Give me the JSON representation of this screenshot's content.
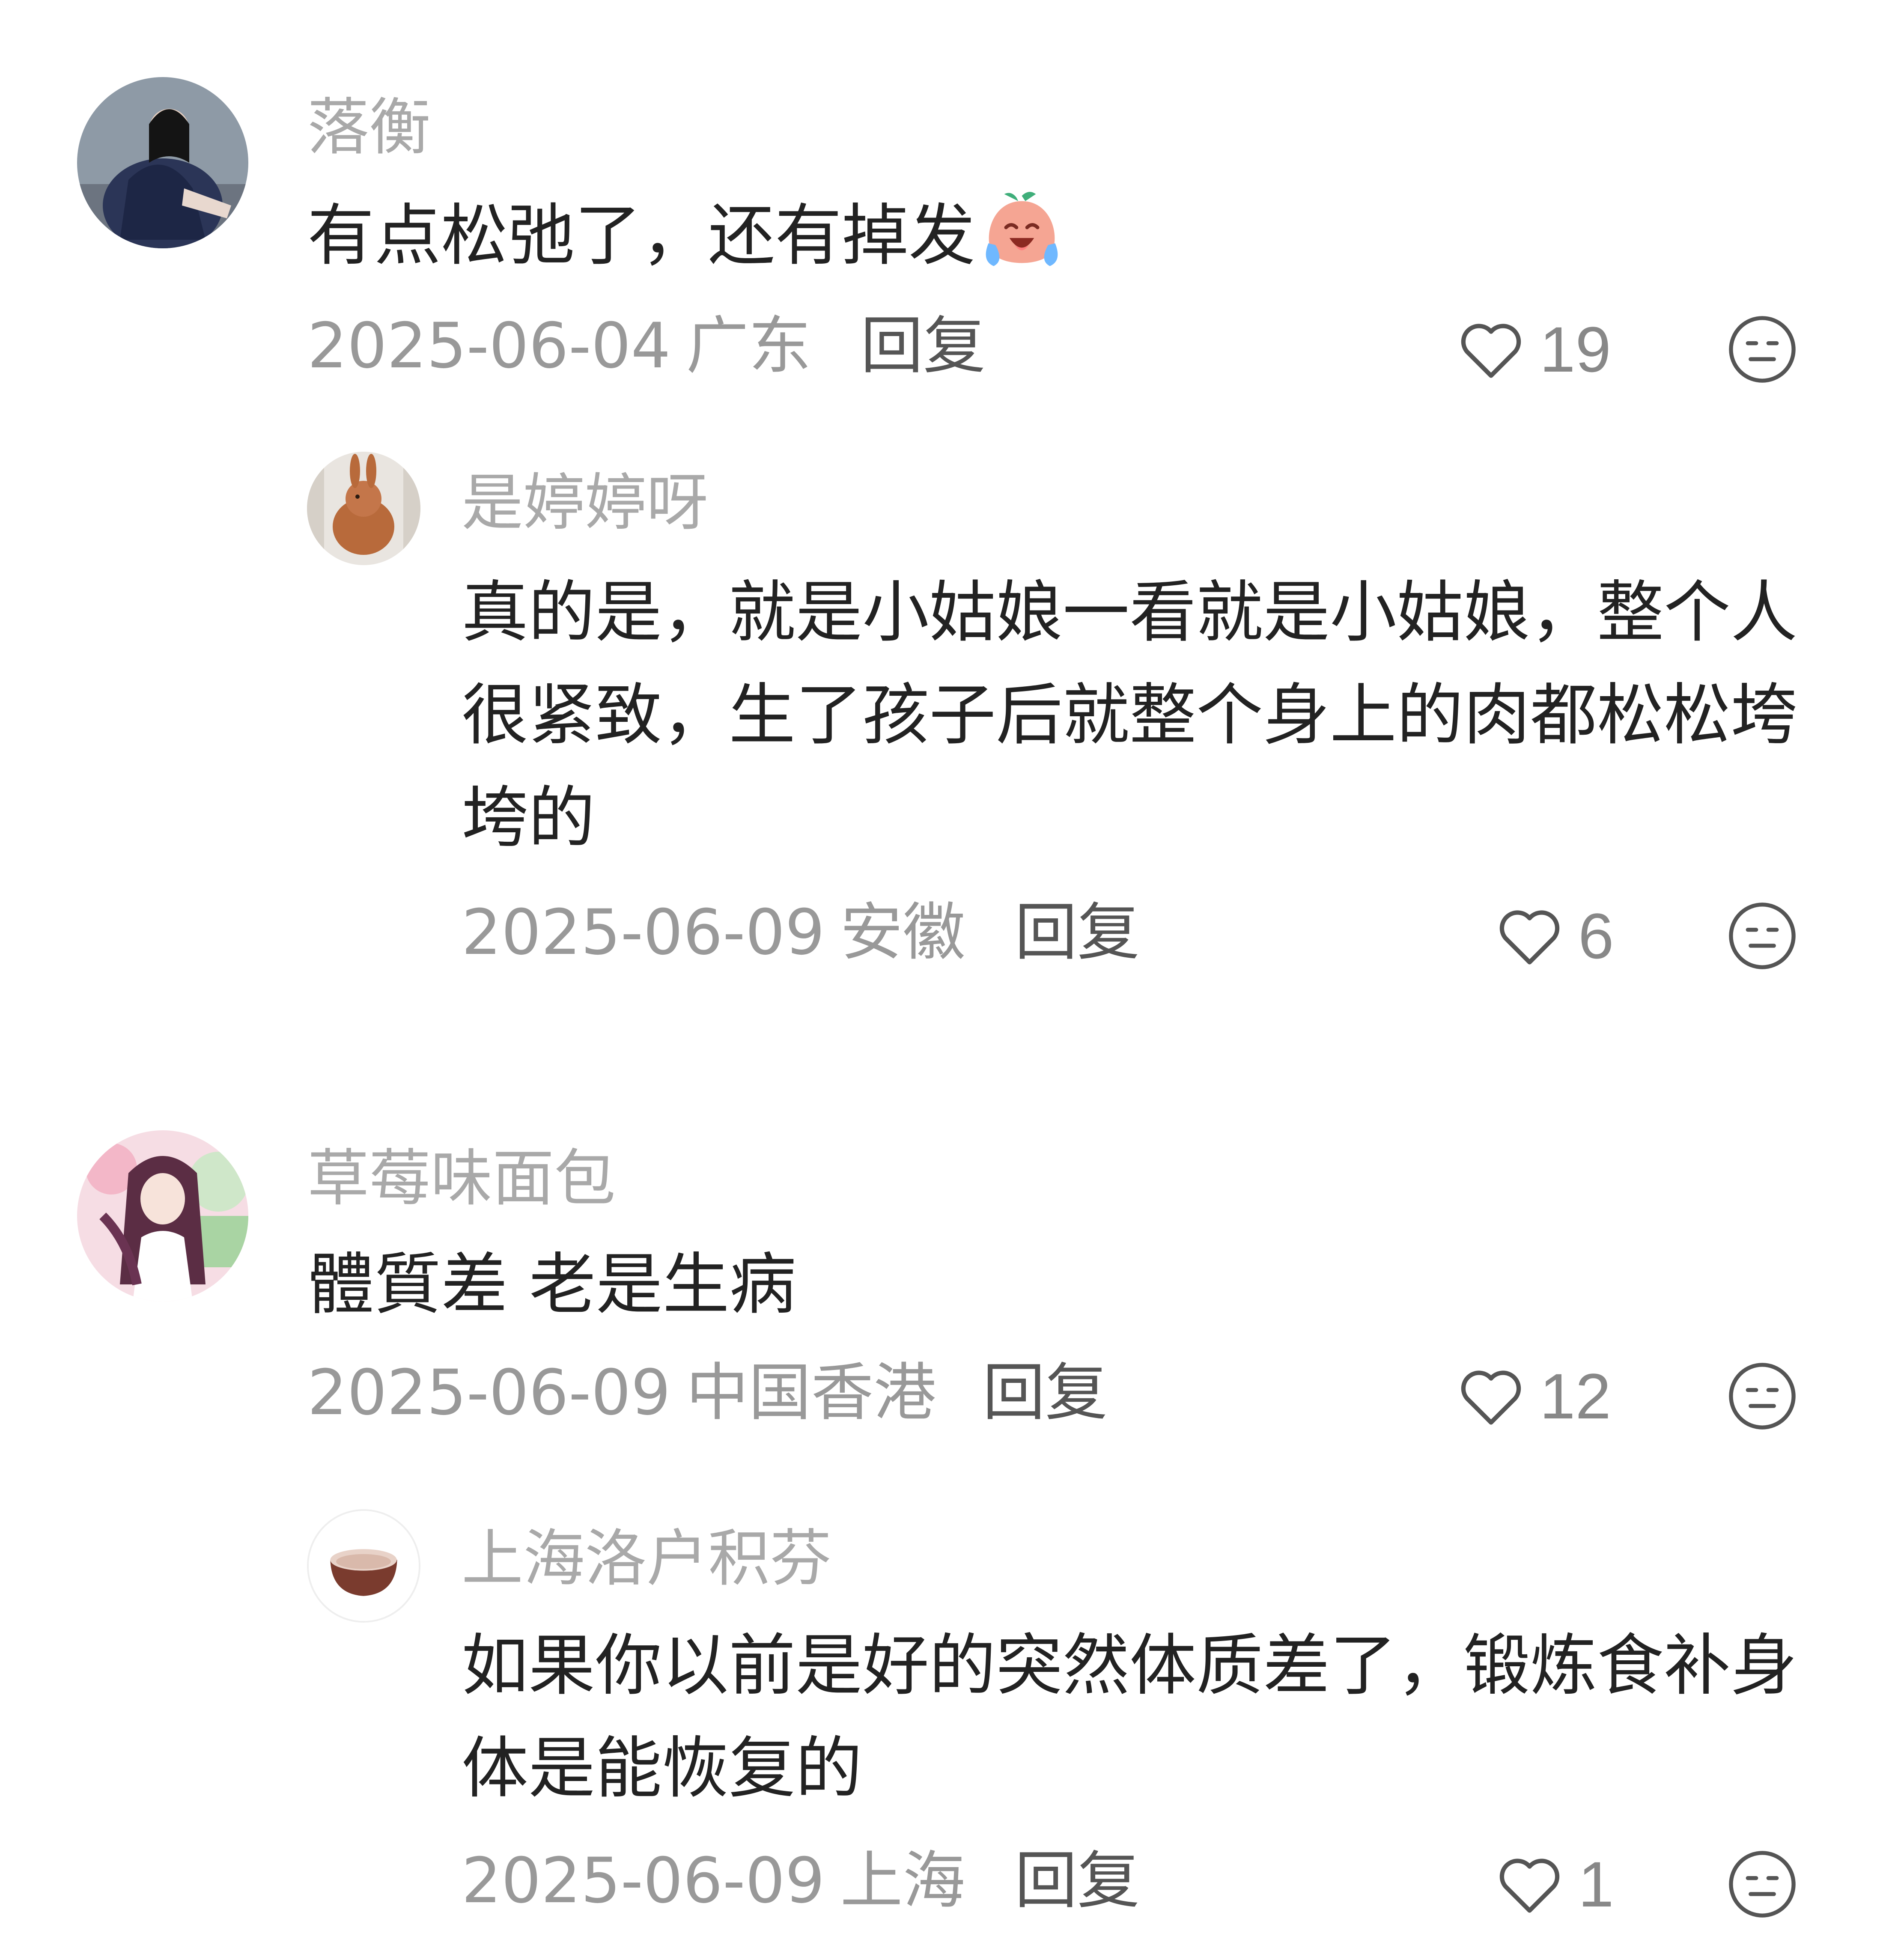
{
  "comments": [
    {
      "author": "落衡",
      "text": "有点松弛了，还有掉发",
      "emoji": "crying-laughing-peach-emoji",
      "date": "2025-06-04",
      "location": "广东",
      "reply_label": "回复",
      "likes": "19",
      "reply": {
        "author": "是婷婷呀",
        "text": "真的是，就是小姑娘一看就是小姑娘，整个人很紧致，生了孩子后就整个身上的肉都松松垮垮的",
        "date": "2025-06-09",
        "location": "安徽",
        "reply_label": "回复",
        "likes": "6"
      }
    },
    {
      "author": "草莓味面包",
      "text": "體質差 老是生病",
      "date": "2025-06-09",
      "location": "中国香港",
      "reply_label": "回复",
      "likes": "12",
      "reply": {
        "author": "上海洛户积芬",
        "text": "如果你以前是好的突然体质差了，锻炼食补身体是能恢复的",
        "date": "2025-06-09",
        "location": "上海",
        "reply_label": "回复",
        "likes": "1"
      }
    }
  ],
  "icons": {
    "like": "heart-outline-icon",
    "dislike": "neutral-face-icon"
  },
  "colors": {
    "author": "#a9a9a9",
    "text": "#222222",
    "meta": "#999999",
    "reply_button": "#555555",
    "icon": "#555555"
  }
}
